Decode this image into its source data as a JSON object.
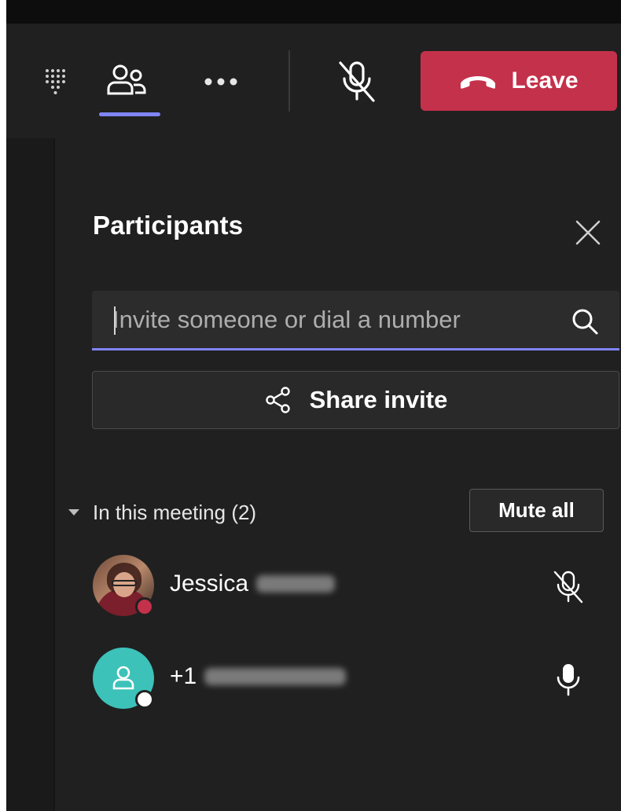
{
  "toolbar": {
    "leave_label": "Leave",
    "leave_color": "#c4314b",
    "active_indicator_color": "#7f85f5",
    "icons": [
      "dialpad-icon",
      "people-icon",
      "more-options-icon",
      "microphone-off-icon",
      "phone-hangup-icon"
    ]
  },
  "panel": {
    "title": "Participants",
    "search": {
      "placeholder": "Invite someone or dial a number",
      "value": ""
    },
    "share_invite_label": "Share invite",
    "section": {
      "label": "In this meeting (2)",
      "mute_all_label": "Mute all"
    },
    "participants": [
      {
        "name": "Jessica",
        "avatar": "photo",
        "status_color": "#c4314b",
        "mic": "microphone-off-icon"
      },
      {
        "name": "+1",
        "avatar": "teal-generic",
        "avatar_color": "#3cc2b9",
        "status_color": "#ffffff",
        "mic": "microphone-icon"
      }
    ]
  }
}
